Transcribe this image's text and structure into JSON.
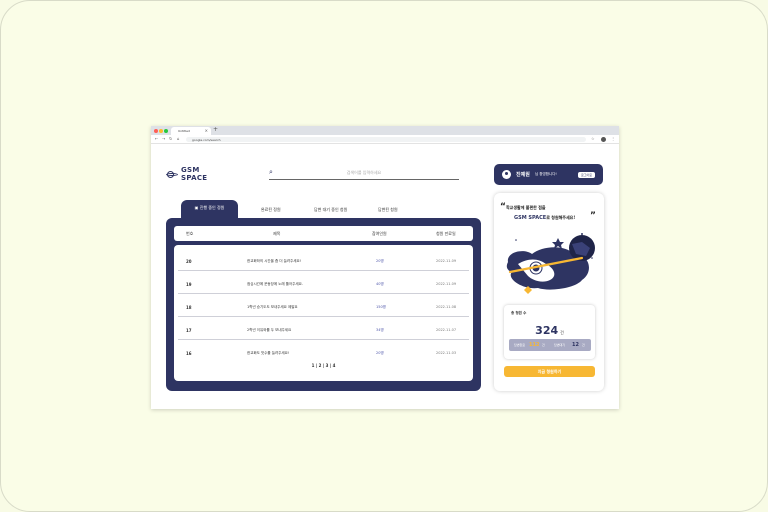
{
  "browser": {
    "tab_title": "Untitled",
    "url": "google.com/search"
  },
  "app": {
    "logo_line1": "GSM",
    "logo_line2": "SPACE"
  },
  "search": {
    "placeholder": "검색어를 입력하세요"
  },
  "user": {
    "name": "진예원",
    "greeting": "님 환영합니다!",
    "logout_label": "로그아웃"
  },
  "tabs": [
    {
      "label": "진행 중인 정원"
    },
    {
      "label": "완료된 정원"
    },
    {
      "label": "답변 대기 중인 청원"
    },
    {
      "label": "답변된 청원"
    }
  ],
  "table": {
    "headers": {
      "num": "번호",
      "title": "제목",
      "count": "참여인원",
      "date": "청원 만료일"
    },
    "rows": [
      {
        "num": "20",
        "title": "한교화하의 시간을 좀 더 늘려주세요!",
        "count": "20명",
        "date": "2022.11.09"
      },
      {
        "num": "19",
        "title": "점심시간에 운동장에 노래 틀어주세요.",
        "count": "40명",
        "date": "2022.11.09"
      },
      {
        "num": "18",
        "title": "1학년 승기도도 보내주세요 제발요",
        "count": "150명",
        "date": "2022.11.08"
      },
      {
        "num": "17",
        "title": "2학년 이유와를 두 보내주세요",
        "count": "34명",
        "date": "2022.11.07"
      },
      {
        "num": "16",
        "title": "한교화도 맛수를 늘려주세요!",
        "count": "20명",
        "date": "2022.11.03"
      }
    ],
    "pagination": "1 | 2 | 3 | 4"
  },
  "sidebar": {
    "quote_open": "“",
    "quote_close": "”",
    "headline_line1": "학교생활에 불편한 점을",
    "headline_brand": "GSM SPACE",
    "headline_line2_rest": "로 청원해주세요!",
    "stats": {
      "label": "총 청원 수",
      "total": "324",
      "total_unit": "건",
      "answered_label": "답변완료",
      "answered_value": "112",
      "answered_unit": "건",
      "pending_label": "답변대기",
      "pending_value": "12",
      "pending_unit": "건"
    },
    "apply_label": "지금 청원하기"
  },
  "colors": {
    "primary": "#2e3462",
    "accent": "#f7b733",
    "background": "#fafde7"
  }
}
